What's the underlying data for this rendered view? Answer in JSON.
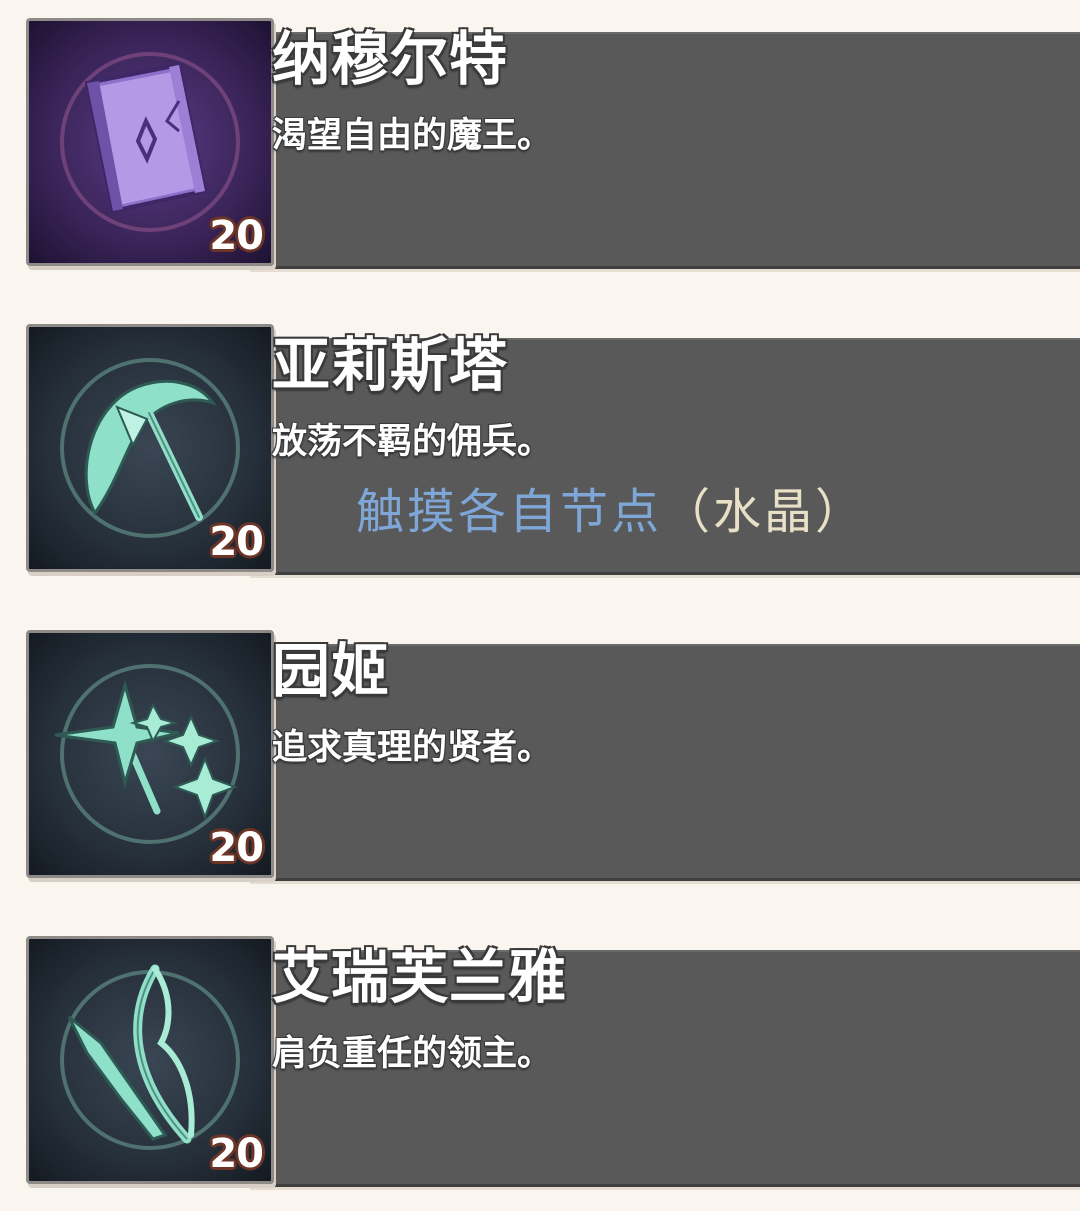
{
  "characters": [
    {
      "name": "纳穆尔特",
      "description": "渴望自由的魔王。",
      "level": "20",
      "icon": "spellbook-icon",
      "frame_color": "#3a2558"
    },
    {
      "name": "亚莉斯塔",
      "description": "放荡不羁的佣兵。",
      "level": "20",
      "icon": "scythe-icon",
      "frame_color": "#1f2a33"
    },
    {
      "name": "园姬",
      "description": "追求真理的贤者。",
      "level": "20",
      "icon": "shuriken-staff-icon",
      "frame_color": "#1f2a33"
    },
    {
      "name": "艾瑞芙兰雅",
      "description": "肩负重任的领主。",
      "level": "20",
      "icon": "bow-icon",
      "frame_color": "#1f2a33"
    }
  ],
  "hint": {
    "main": "触摸各自节点",
    "paren": "（水晶）"
  }
}
